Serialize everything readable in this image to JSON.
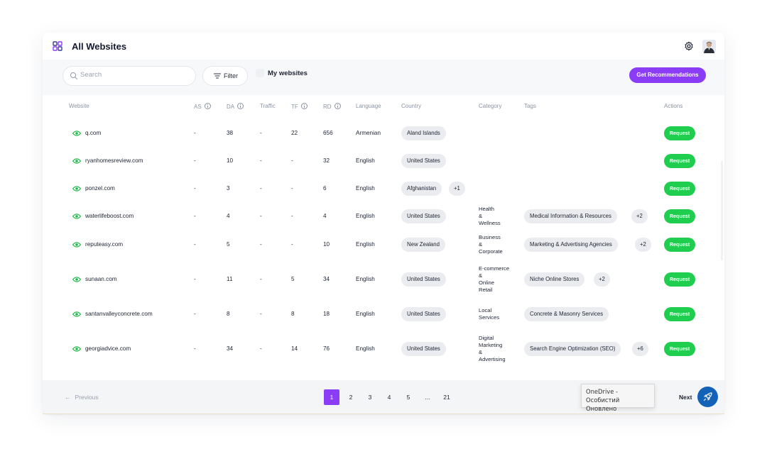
{
  "header": {
    "title": "All Websites"
  },
  "toolbar": {
    "search_placeholder": "Search",
    "filter_label": "Filter",
    "my_websites_label": "My websites",
    "recommendations_label": "Get Recommendations"
  },
  "columns": {
    "website": "Website",
    "as": "AS",
    "da": "DA",
    "traffic": "Traffic",
    "tf": "TF",
    "rd": "RD",
    "language": "Language",
    "country": "Country",
    "category": "Category",
    "tags": "Tags",
    "actions": "Actions"
  },
  "request_label": "Request",
  "rows": [
    {
      "website": "q.com",
      "as": "-",
      "da": "38",
      "traffic": "-",
      "tf": "22",
      "rd": "656",
      "language": "Armenian",
      "country": "Aland Islands",
      "country_more": "",
      "category": "",
      "tag": "",
      "tag_more": ""
    },
    {
      "website": "ryanhomesreview.com",
      "as": "-",
      "da": "10",
      "traffic": "-",
      "tf": "-",
      "rd": "32",
      "language": "English",
      "country": "United States",
      "country_more": "",
      "category": "",
      "tag": "",
      "tag_more": ""
    },
    {
      "website": "ponzel.com",
      "as": "-",
      "da": "3",
      "traffic": "-",
      "tf": "-",
      "rd": "6",
      "language": "English",
      "country": "Afghanistan",
      "country_more": "+1",
      "category": "",
      "tag": "",
      "tag_more": ""
    },
    {
      "website": "waterlifeboost.com",
      "as": "-",
      "da": "4",
      "traffic": "-",
      "tf": "-",
      "rd": "4",
      "language": "English",
      "country": "United States",
      "country_more": "",
      "category": "Health & Wellness",
      "tag": "Medical Information & Resources",
      "tag_more": "+2"
    },
    {
      "website": "reputeasy.com",
      "as": "-",
      "da": "5",
      "traffic": "-",
      "tf": "-",
      "rd": "10",
      "language": "English",
      "country": "New Zealand",
      "country_more": "",
      "category": "Business & Corporate",
      "tag": "Marketing & Advertising Agencies",
      "tag_more": "+2"
    },
    {
      "website": "sunaan.com",
      "as": "-",
      "da": "11",
      "traffic": "-",
      "tf": "5",
      "rd": "34",
      "language": "English",
      "country": "United States",
      "country_more": "",
      "category": "E-commerce & Online Retail",
      "tag": "Niche Online Stores",
      "tag_more": "+2"
    },
    {
      "website": "santanvalleyconcrete.com",
      "as": "-",
      "da": "8",
      "traffic": "-",
      "tf": "8",
      "rd": "18",
      "language": "English",
      "country": "United States",
      "country_more": "",
      "category": "Local Services",
      "tag": "Concrete & Masonry Services",
      "tag_more": ""
    },
    {
      "website": "georgiadvice.com",
      "as": "-",
      "da": "34",
      "traffic": "-",
      "tf": "14",
      "rd": "76",
      "language": "English",
      "country": "United States",
      "country_more": "",
      "category": "Digital Marketing & Advertising",
      "tag": "Search Engine Optimization (SEO)",
      "tag_more": "+6"
    }
  ],
  "pagination": {
    "previous_label": "Previous",
    "next_label": "Next",
    "pages": [
      "1",
      "2",
      "3",
      "4",
      "5",
      "...",
      "21"
    ],
    "current": "1"
  },
  "notification": {
    "line1": "OneDrive - Особистий",
    "line2": "Оновлено"
  },
  "colors": {
    "accent": "#8b3cf7",
    "request_green": "#1fce4f",
    "eye_green": "#22b84a",
    "fab_blue": "#1462b8"
  },
  "icons": {
    "logo": "app-logo-icon",
    "settings": "gear-icon",
    "search": "search-icon",
    "filter": "filter-icon",
    "visibility": "eye-icon",
    "previous": "arrow-left-icon",
    "fab": "rocket-icon"
  }
}
